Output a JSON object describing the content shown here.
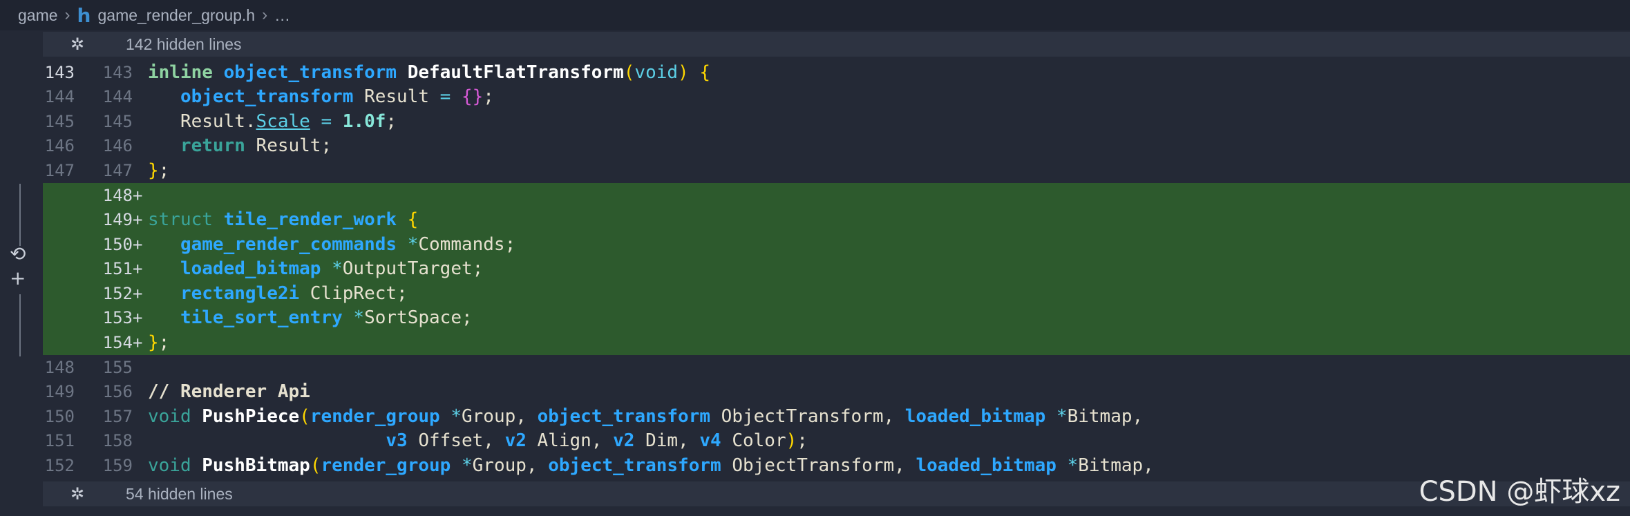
{
  "breadcrumb": {
    "folder": "game",
    "file_icon": "h",
    "file": "game_render_group.h",
    "more": "…"
  },
  "hidden_top": {
    "icon": "unfold-icon",
    "label": "142 hidden lines"
  },
  "hidden_bottom": {
    "icon": "unfold-icon",
    "label": "54 hidden lines"
  },
  "lines": [
    {
      "old": "143",
      "new": "143"
    },
    {
      "old": "144",
      "new": "144"
    },
    {
      "old": "145",
      "new": "145"
    },
    {
      "old": "146",
      "new": "146"
    },
    {
      "old": "147",
      "new": "147"
    },
    {
      "old": "",
      "new": "148",
      "marker": "+"
    },
    {
      "old": "",
      "new": "149",
      "marker": "+"
    },
    {
      "old": "",
      "new": "150",
      "marker": "+"
    },
    {
      "old": "",
      "new": "151",
      "marker": "+"
    },
    {
      "old": "",
      "new": "152",
      "marker": "+"
    },
    {
      "old": "",
      "new": "153",
      "marker": "+"
    },
    {
      "old": "",
      "new": "154",
      "marker": "+"
    },
    {
      "old": "148",
      "new": "155"
    },
    {
      "old": "149",
      "new": "156"
    },
    {
      "old": "150",
      "new": "157"
    },
    {
      "old": "151",
      "new": "158"
    },
    {
      "old": "152",
      "new": "159"
    }
  ],
  "code": {
    "l143": {
      "t1": "inline",
      "t2": "object_transform",
      "t3": "DefaultFlatTransform",
      "t4": "(",
      "t5": "void",
      "t6": ")",
      "t7": " {"
    },
    "l144": {
      "t1": "object_transform",
      "t2": " Result ",
      "t3": "=",
      "t4": " {}",
      "t5": ";"
    },
    "l145": {
      "t1": "Result.",
      "t2": "Scale",
      "t3": " = ",
      "t4": "1.0f",
      "t5": ";"
    },
    "l146": {
      "t1": "return",
      "t2": " Result;"
    },
    "l147": {
      "t1": "}",
      "t2": ";"
    },
    "l149": {
      "t1": "struct",
      "t2": "tile_render_work",
      "t3": " {"
    },
    "l150": {
      "t1": "game_render_commands",
      "t2": " *",
      "t3": "Commands;"
    },
    "l151": {
      "t1": "loaded_bitmap",
      "t2": " *",
      "t3": "OutputTarget;"
    },
    "l152": {
      "t1": "rectangle2i",
      "t2": " ClipRect;"
    },
    "l153": {
      "t1": "tile_sort_entry",
      "t2": " *",
      "t3": "SortSpace;"
    },
    "l154": {
      "t1": "}",
      "t2": ";"
    },
    "l156": {
      "t1": "// Renderer Api"
    },
    "l157": {
      "t1": "void",
      "t2": "PushPiece",
      "t3": "(",
      "t4": "render_group",
      "t5": " *",
      "t6": "Group, ",
      "t7": "object_transform",
      "t8": " ObjectTransform, ",
      "t9": "loaded_bitmap",
      "t10": " *",
      "t11": "Bitmap,"
    },
    "l158": {
      "t1": "v3",
      "t2": " Offset, ",
      "t3": "v2",
      "t4": " Align, ",
      "t5": "v2",
      "t6": " Dim, ",
      "t7": "v4",
      "t8": " Color",
      "t9": ")",
      "t10": ";"
    },
    "l159": {
      "t1": "void",
      "t2": "PushBitmap",
      "t3": "(",
      "t4": "render_group",
      "t5": " *",
      "t6": "Group, ",
      "t7": "object_transform",
      "t8": " ObjectTransform, ",
      "t9": "loaded_bitmap",
      "t10": " *",
      "t11": "Bitmap,"
    }
  },
  "edit_controls": {
    "revert_icon": "undo-icon",
    "add_icon": "plus-icon"
  },
  "watermark": "CSDN @虾球xz"
}
